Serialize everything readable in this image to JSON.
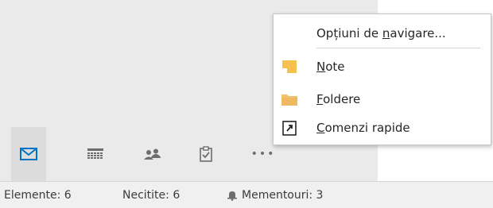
{
  "nav": {
    "items": [
      {
        "name": "mail",
        "icon": "envelope-icon",
        "selected": true
      },
      {
        "name": "calendar",
        "icon": "calendar-icon",
        "selected": false
      },
      {
        "name": "people",
        "icon": "people-icon",
        "selected": false
      },
      {
        "name": "tasks",
        "icon": "clipboard-check-icon",
        "selected": false
      },
      {
        "name": "more",
        "icon": "ellipsis-icon",
        "selected": false,
        "label": "•••"
      }
    ]
  },
  "menu": {
    "nav_options": {
      "before": "Opțiuni de ",
      "key": "n",
      "after": "avigare..."
    },
    "notes": {
      "key": "N",
      "rest": "ote",
      "icon": "note-icon"
    },
    "folders": {
      "key": "F",
      "rest": "oldere",
      "icon": "folder-icon"
    },
    "shortcuts": {
      "key": "C",
      "rest": "omenzi rapide",
      "icon": "shortcut-icon"
    }
  },
  "status": {
    "items_label": "Elemente: 6",
    "unread_label": "Necitite: 6",
    "reminders_label": "Mementouri: 3",
    "reminders_icon": "bell-icon"
  },
  "colors": {
    "accent": "#0072c6",
    "note_yellow": "#f6c04d",
    "folder_yellow": "#f2c16d",
    "nav_icon_gray": "#6d6d6d"
  }
}
